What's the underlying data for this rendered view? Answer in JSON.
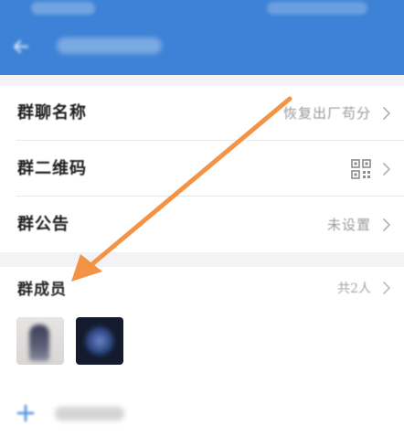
{
  "settings": {
    "group_name_label": "群聊名称",
    "group_name_value": "恢复出厂苟分",
    "qr_label": "群二维码",
    "notice_label": "群公告",
    "notice_value": "未设置"
  },
  "members": {
    "label": "群成员",
    "count": "共2人"
  },
  "icons": {
    "back": "back-arrow-icon",
    "qr": "qr-code-icon",
    "chevron": "chevron-right-icon",
    "plus": "plus-icon"
  },
  "colors": {
    "header_bg": "#3d82d6",
    "annotation_arrow": "#f39345",
    "plus_accent": "#4a90e2"
  }
}
